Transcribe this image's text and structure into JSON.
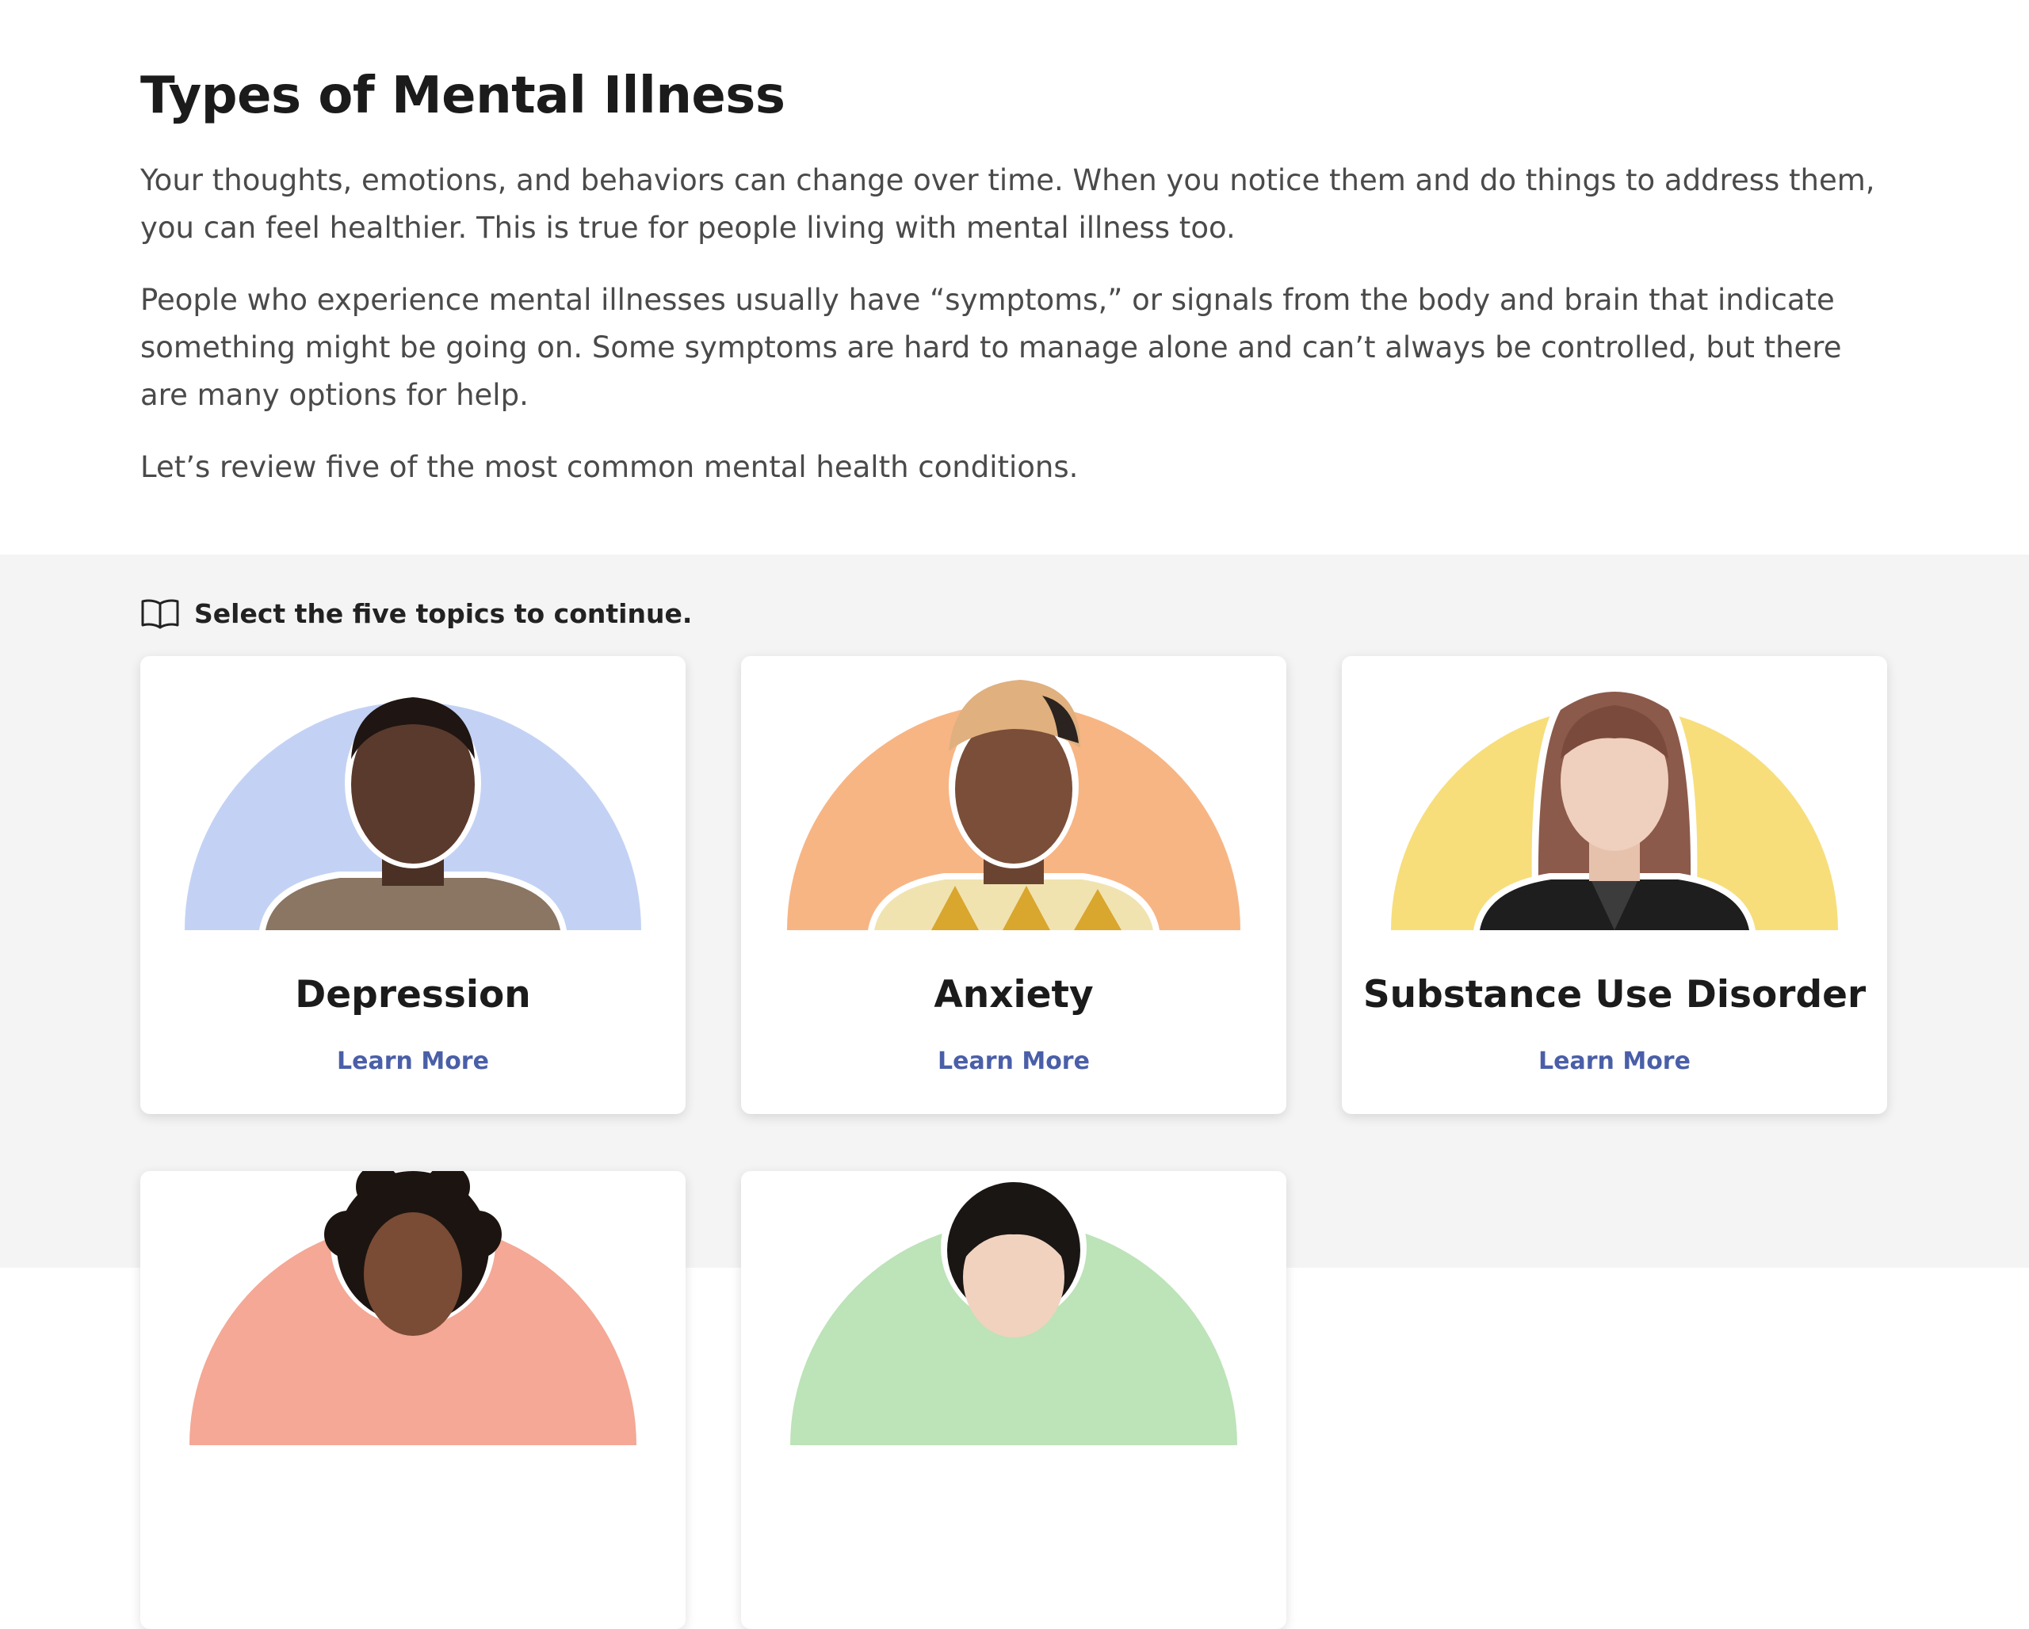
{
  "intro": {
    "title": "Types of Mental Illness",
    "paragraphs": [
      "Your thoughts, emotions, and behaviors can change over time. When you notice them and do things to address them, you can feel healthier. This is true for people living with mental illness too.",
      "People who experience mental illnesses usually have “symptoms,” or signals from the body and brain that indicate something might be going on. Some symptoms are hard to manage alone and can’t always be controlled, but there are many options for help.",
      "Let’s review five of the most common mental health conditions."
    ]
  },
  "topics": {
    "icon": "book-icon",
    "instruction": "Select the five topics to continue.",
    "cards": [
      {
        "title": "Depression",
        "link_label": "Learn More",
        "accent": "#c3d2f4"
      },
      {
        "title": "Anxiety",
        "link_label": "Learn More",
        "accent": "#f7b584"
      },
      {
        "title": "Substance Use Disorder",
        "link_label": "Learn More",
        "accent": "#f7de7a"
      },
      {
        "title": "",
        "link_label": "",
        "accent": "#f4a895"
      },
      {
        "title": "",
        "link_label": "",
        "accent": "#bde3b8"
      }
    ]
  },
  "colors": {
    "page_bg": "#ffffff",
    "section_bg": "#f4f4f4",
    "link": "#4a5fa8",
    "heading": "#1b1b1b",
    "body_text": "#4a4a4a"
  }
}
